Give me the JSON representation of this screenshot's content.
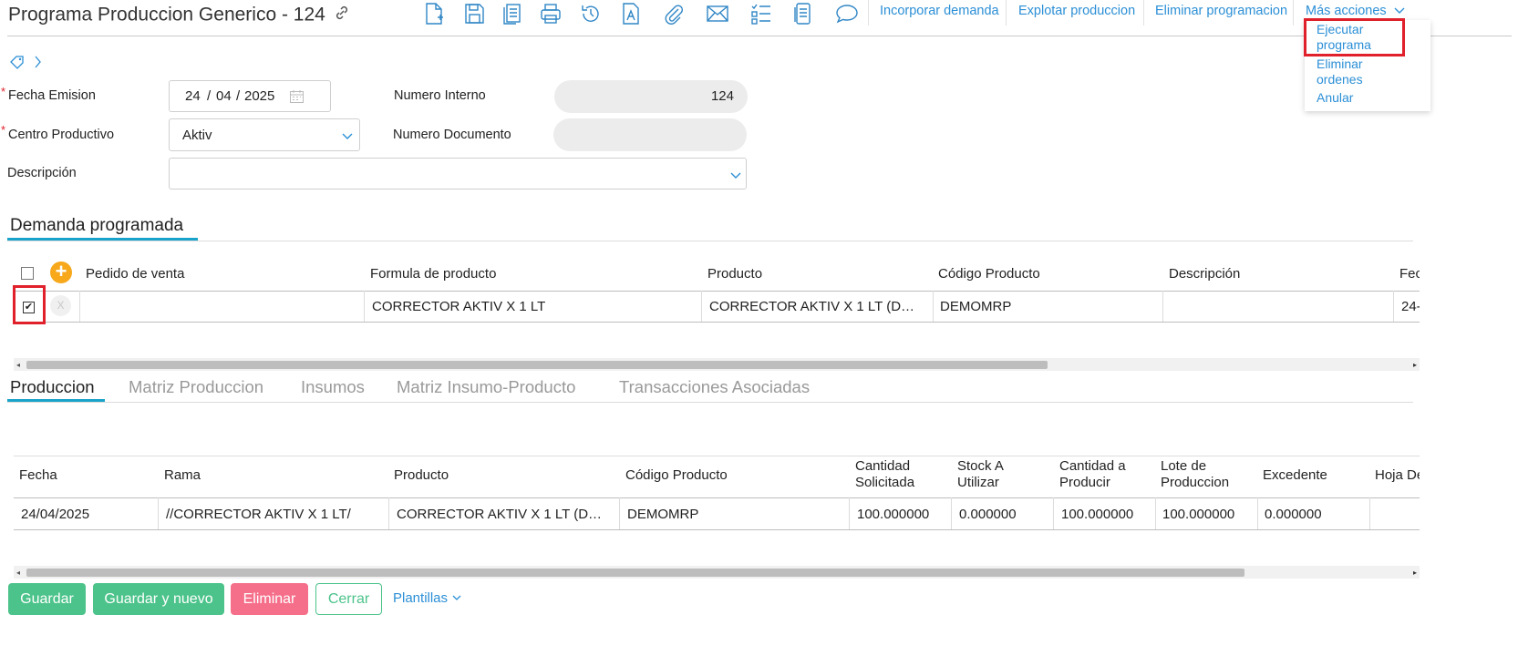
{
  "header": {
    "title": "Programa Produccion Generico - 124",
    "actions": {
      "incorporar": "Incorporar demanda",
      "explotar": "Explotar produccion",
      "eliminar_prog": "Eliminar programacion",
      "mas_acciones": "Más acciones"
    },
    "menu": {
      "ejecutar_1": "Ejecutar",
      "ejecutar_2": "programa",
      "eliminar_1": "Eliminar",
      "eliminar_2": "ordenes",
      "anular": "Anular"
    }
  },
  "form": {
    "fecha_emision_label": "Fecha Emision",
    "fecha_day": "24",
    "fecha_month": "04",
    "fecha_year": "2025",
    "centro_label": "Centro Productivo",
    "centro_value": "Aktiv",
    "descripcion_label": "Descripción",
    "descripcion_value": "",
    "numero_interno_label": "Numero Interno",
    "numero_interno_value": "124",
    "numero_documento_label": "Numero Documento",
    "numero_documento_value": "",
    "required_mark": "*"
  },
  "demanda": {
    "title": "Demanda programada",
    "columns": [
      "Pedido de venta",
      "Formula de producto",
      "Producto",
      "Código Producto",
      "Descripción",
      "Fec"
    ],
    "row": [
      "",
      "CORRECTOR AKTIV X 1 LT",
      "CORRECTOR AKTIV X 1 LT (D…",
      "DEMOMRP",
      "",
      "24-"
    ],
    "add_symbol": "+",
    "remove_symbol": "X"
  },
  "tabs": [
    "Produccion",
    "Matriz Produccion",
    "Insumos",
    "Matriz Insumo-Producto",
    "Transacciones Asociadas"
  ],
  "produccion": {
    "columns": [
      "Fecha",
      "Rama",
      "Producto",
      "Código Producto",
      "Cantidad\nSolicitada",
      "Stock A\nUtilizar",
      "Cantidad a\nProducir",
      "Lote de\nProduccion",
      "Excedente",
      "Hoja De"
    ],
    "row": [
      "24/04/2025",
      "//CORRECTOR AKTIV X 1 LT/",
      "CORRECTOR AKTIV X 1 LT (D…",
      "DEMOMRP",
      "100.000000",
      "0.000000",
      "100.000000",
      "100.000000",
      "0.000000",
      ""
    ]
  },
  "footer": {
    "guardar": "Guardar",
    "guardar_nuevo": "Guardar y nuevo",
    "eliminar": "Eliminar",
    "cerrar": "Cerrar",
    "plantillas": "Plantillas"
  },
  "colors": {
    "accent": "#2b8fd6",
    "tab_underline": "#1aa3c9",
    "green": "#4cc38a",
    "pink": "#f66f8a",
    "highlight": "#e0202a"
  },
  "icons": [
    "new-doc-icon",
    "save-icon",
    "copy-icon",
    "print-icon",
    "history-icon",
    "text-doc-icon",
    "attach-icon",
    "mail-icon",
    "checklist-icon",
    "doc-list-icon",
    "comment-icon",
    "link-icon",
    "tag-icon",
    "calendar-icon"
  ]
}
